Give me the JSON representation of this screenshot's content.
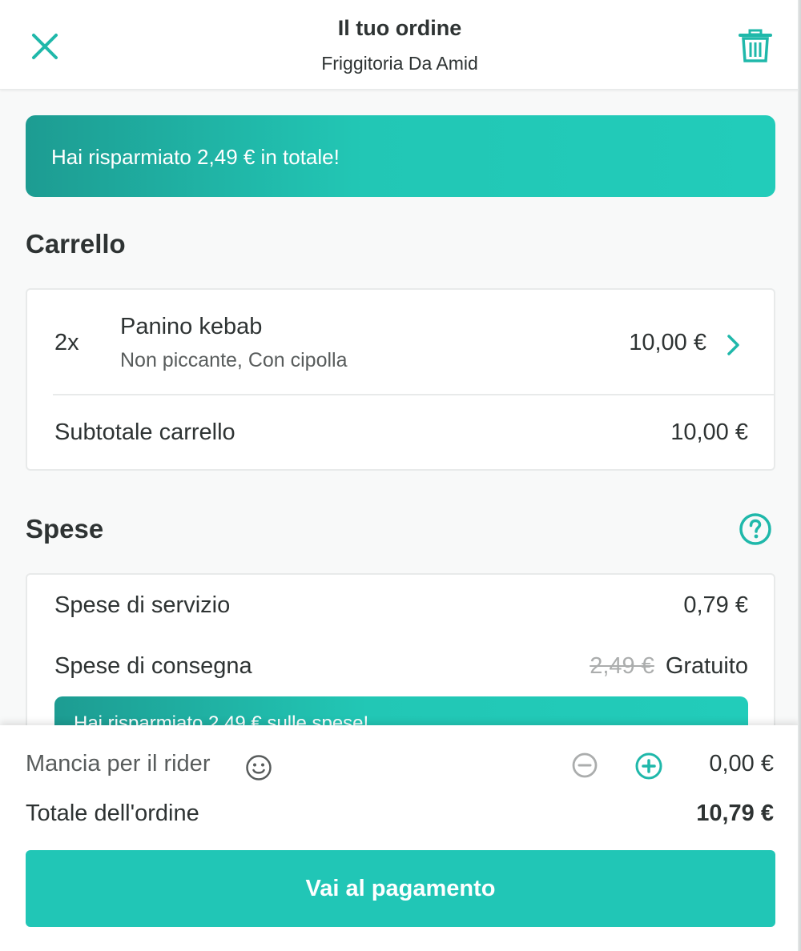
{
  "header": {
    "title": "Il tuo ordine",
    "subtitle": "Friggitoria Da Amid",
    "close_icon": "close-icon",
    "trash_icon": "trash-icon"
  },
  "savings_banner": {
    "text": "Hai risparmiato 2,49 € in totale!"
  },
  "cart": {
    "title": "Carrello",
    "items": [
      {
        "quantity": "2x",
        "name": "Panino kebab",
        "options": "Non piccante, Con cipolla",
        "price": "10,00 €"
      }
    ],
    "subtotal_label": "Subtotale carrello",
    "subtotal_value": "10,00 €"
  },
  "fees": {
    "title": "Spese",
    "service_label": "Spese di servizio",
    "service_value": "0,79 €",
    "delivery_label": "Spese di consegna",
    "delivery_old_value": "2,49 €",
    "delivery_value": "Gratuito",
    "savings_text": "Hai risparmiato 2,49 € sulle spese!"
  },
  "footer": {
    "tip_label": "Mancia per il rider",
    "tip_value": "0,00 €",
    "total_label": "Totale dell'ordine",
    "total_value": "10,79 €",
    "pay_button": "Vai al pagamento"
  },
  "colors": {
    "accent": "#00ccbc",
    "text": "#2e3333",
    "muted": "#585c5c"
  }
}
